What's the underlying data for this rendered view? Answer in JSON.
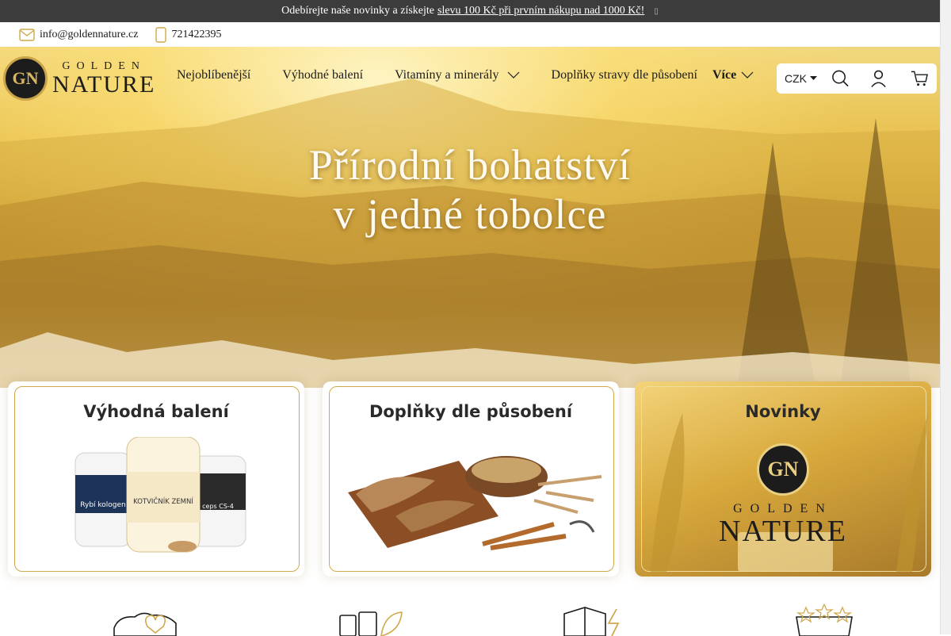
{
  "announcement": {
    "text": "Odebírejte naše novinky a získejte",
    "link": "slevu 100 Kč při prvním nákupu nad 1000 Kč!",
    "close_glyph": "▯"
  },
  "contact": {
    "email": "info@goldennature.cz",
    "phone": "721422395",
    "email_icon": "mail-icon",
    "phone_icon": "phone-icon"
  },
  "logo": {
    "top": "GOLDEN",
    "bottom": "NATURE",
    "monogram": "GN"
  },
  "nav": {
    "items": [
      {
        "label": "Nejoblíbenější"
      },
      {
        "label": "Výhodné balení"
      },
      {
        "label": "Vitamíny a minerály"
      },
      {
        "label": "Doplňky stravy dle působení"
      }
    ],
    "more_label": "Více"
  },
  "toolbar": {
    "currency": "CZK",
    "icons": [
      "search-icon",
      "user-icon",
      "cart-icon"
    ]
  },
  "hero": {
    "line1": "Přírodní bohatství",
    "line2": "v jedné tobolce"
  },
  "cards": [
    {
      "title": "Výhodná balení",
      "label_1": "Rybí kologen",
      "label_2": "KOTVIČNÍK ZEMNÍ",
      "label_3": "ceps CS-4"
    },
    {
      "title": "Doplňky dle působení"
    },
    {
      "title": "Novinky",
      "brand_top": "GOLDEN",
      "brand_bottom": "NATURE"
    }
  ],
  "colors": {
    "gold": "#cfa94c",
    "dark": "#1c1c1c",
    "announce_bg": "#3c3c3c"
  }
}
